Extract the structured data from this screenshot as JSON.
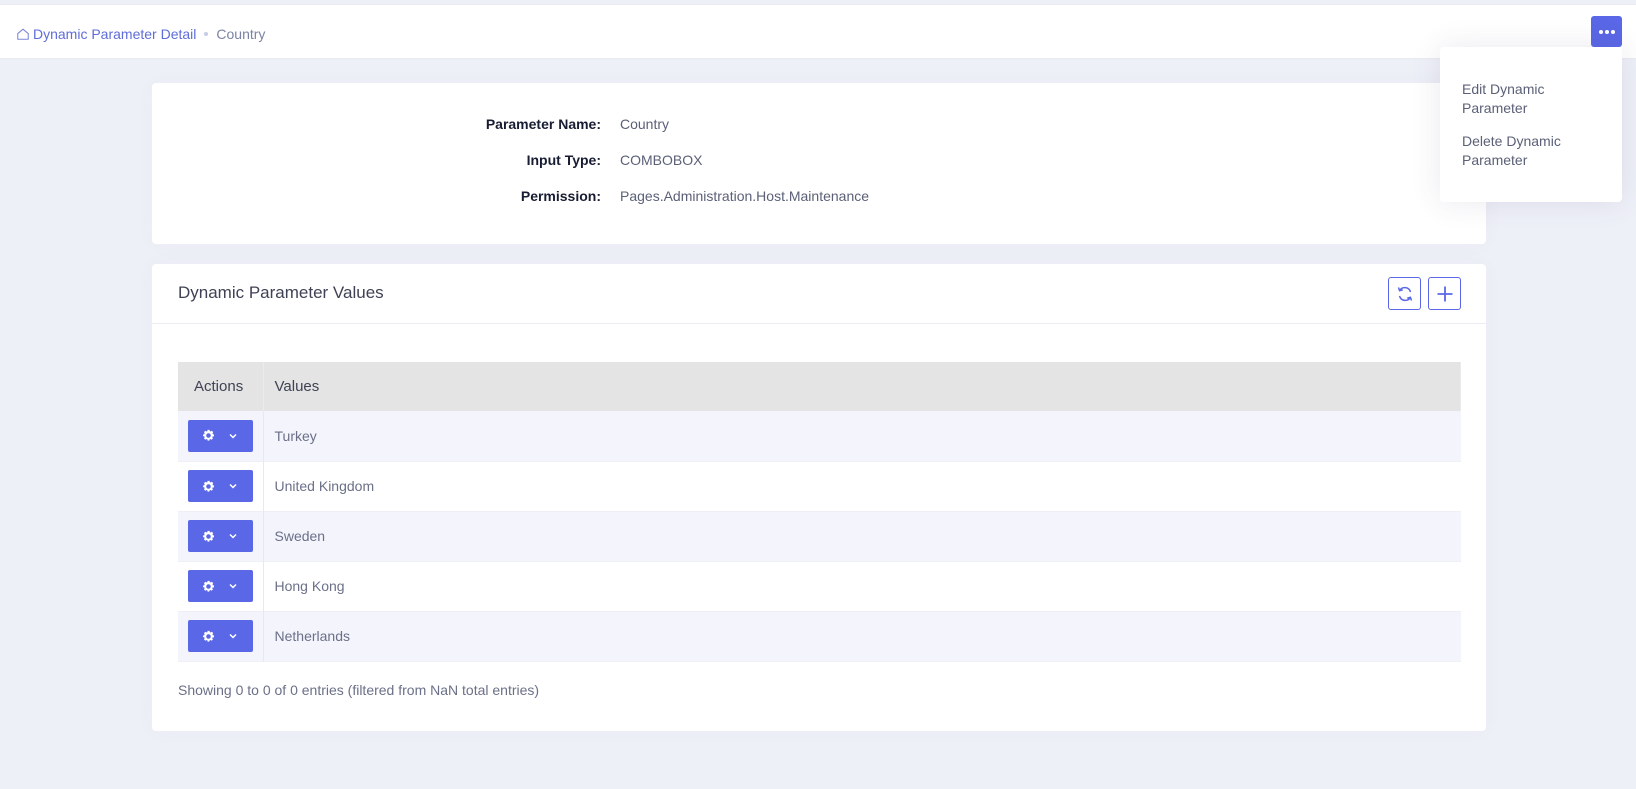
{
  "breadcrumb": {
    "parent": "Dynamic Parameter Detail",
    "current": "Country"
  },
  "dropdown": {
    "items": [
      "Edit Dynamic Parameter",
      "Delete Dynamic Parameter"
    ]
  },
  "details": {
    "rows": [
      {
        "label": "Parameter Name:",
        "value": "Country"
      },
      {
        "label": "Input Type:",
        "value": "COMBOBOX"
      },
      {
        "label": "Permission:",
        "value": "Pages.Administration.Host.Maintenance"
      }
    ]
  },
  "values_section": {
    "title": "Dynamic Parameter Values",
    "columns": [
      "Actions",
      "Values"
    ],
    "rows": [
      "Turkey",
      "United Kingdom",
      "Sweden",
      "Hong Kong",
      "Netherlands"
    ],
    "footer": "Showing 0 to 0 of 0 entries (filtered from NaN total entries)"
  },
  "colors": {
    "accent": "#5a67e6",
    "background": "#eef0f8"
  },
  "icons": {
    "home": "home-icon",
    "more": "more-horizontal-icon",
    "refresh": "refresh-icon",
    "add": "plus-icon",
    "gear": "gear-icon",
    "chevron": "chevron-down-icon"
  }
}
